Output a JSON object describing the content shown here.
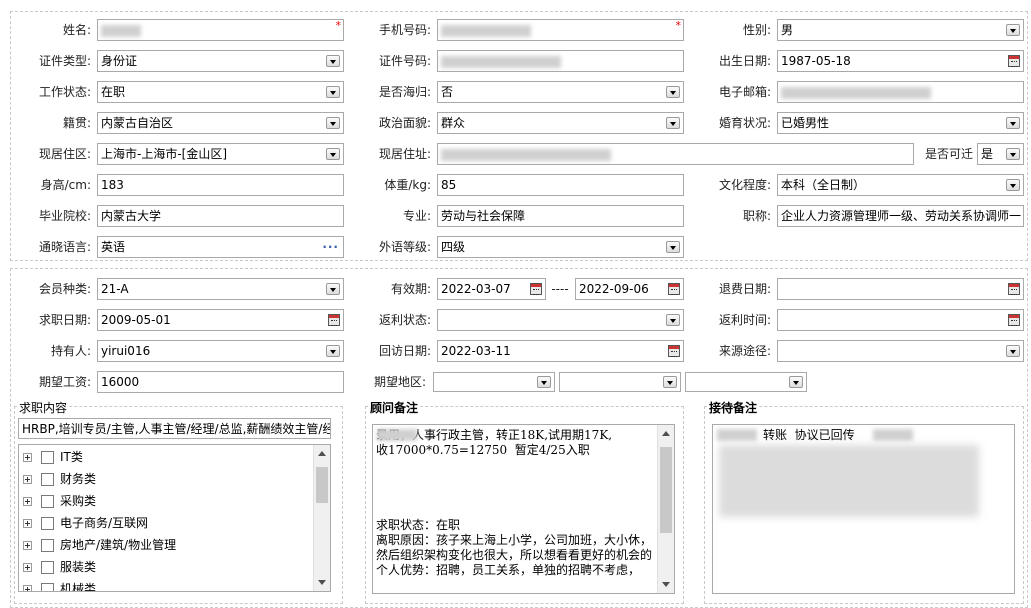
{
  "personal": {
    "name_label": "姓名:",
    "phone_label": "手机号码:",
    "gender_label": "性别:",
    "gender": "男",
    "id_type_label": "证件类型:",
    "id_type": "身份证",
    "id_no_label": "证件号码:",
    "birth_label": "出生日期:",
    "birth": "1987-05-18",
    "work_status_label": "工作状态:",
    "work_status": "在职",
    "returnee_label": "是否海归:",
    "returnee": "否",
    "email_label": "电子邮箱:",
    "native_label": "籍贯:",
    "native": "内蒙古自治区",
    "political_label": "政治面貌:",
    "political": "群众",
    "marital_label": "婚育状况:",
    "marital": "已婚男性",
    "residence_label": "现居住区:",
    "residence": "上海市-上海市-[金山区]",
    "address_label": "现居住址:",
    "reachable_label": "是否可迁",
    "reachable": "是",
    "height_label": "身高/cm:",
    "height": "183",
    "weight_label": "体重/kg:",
    "weight": "85",
    "education_label": "文化程度:",
    "education": "本科（全日制）",
    "school_label": "毕业院校:",
    "school": "内蒙古大学",
    "major_label": "专业:",
    "major": "劳动与社会保障",
    "title_label": "职称:",
    "title": "企业人力资源管理师一级、劳动关系协调师一",
    "language_label": "通晓语言:",
    "language": "英语",
    "lang_level_label": "外语等级:",
    "lang_level": "四级",
    "required_mark": "*"
  },
  "membership": {
    "type_label": "会员种类:",
    "type": "21-A",
    "valid_label": "有效期:",
    "valid_from": "2022-03-07",
    "valid_sep": "----",
    "valid_to": "2022-09-06",
    "refund_date_label": "退费日期:",
    "refund_date": "",
    "job_date_label": "求职日期:",
    "job_date": "2009-05-01",
    "rebate_status_label": "返利状态:",
    "rebate_status": "",
    "rebate_time_label": "返利时间:",
    "rebate_time": "",
    "holder_label": "持有人:",
    "holder": "yirui016",
    "visit_date_label": "回访日期:",
    "visit_date": "2022-03-11",
    "source_label": "来源途径:",
    "source": "",
    "salary_label": "期望工资:",
    "salary": "16000",
    "region_label": "期望地区:"
  },
  "job_intent": {
    "title": "求职内容",
    "summary": "HRBP,培训专员/主管,人事主管/经理/总监,薪酬绩效主管/经",
    "categories": [
      "IT类",
      "财务类",
      "采购类",
      "电子商务/互联网",
      "房地产/建筑/物业管理",
      "服装类",
      "机械类"
    ]
  },
  "consultant_notes": {
    "title": "顾问备注",
    "text": "录用，人事行政主管，转正18K,试用期17K,\n收17000*0.75=12750  暂定4/25入职\n\n\n\n\n求职状态：在职\n离职原因：孩子来上海上小学，公司加班，大小休，然后组织架构变化也很大，所以想看看更好的机会的\n个人优势：招聘，员工关系，单独的招聘不考虑，"
  },
  "reception_notes": {
    "title": "接待备注",
    "text": "转账  协议已回传"
  }
}
